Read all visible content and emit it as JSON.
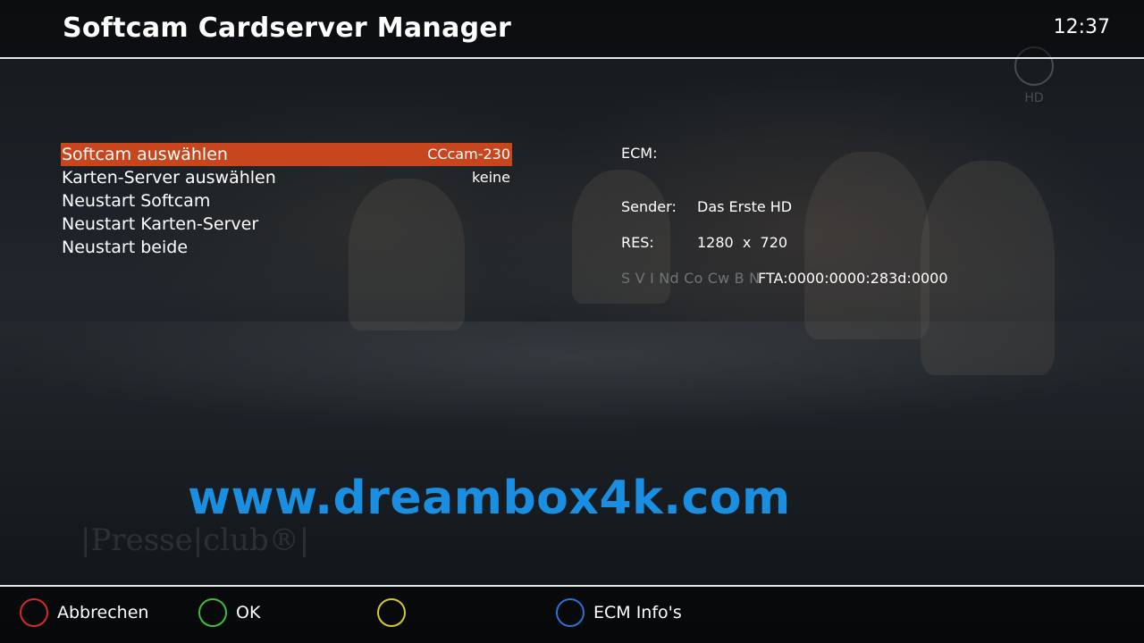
{
  "header": {
    "title": "Softcam Cardserver Manager",
    "clock": "12:37"
  },
  "channel_badge": {
    "label": "HD"
  },
  "menu": {
    "items": [
      {
        "label": "Softcam auswählen",
        "value": "CCcam-230",
        "selected": true
      },
      {
        "label": "Karten-Server auswählen",
        "value": "keine",
        "selected": false
      },
      {
        "label": "Neustart Softcam",
        "value": "",
        "selected": false
      },
      {
        "label": "Neustart Karten-Server",
        "value": "",
        "selected": false
      },
      {
        "label": "Neustart beide",
        "value": "",
        "selected": false
      }
    ],
    "selected_color": "#c8461e"
  },
  "info": {
    "ecm_label": "ECM:",
    "ecm_value": "",
    "sender_label": "Sender:",
    "sender_value": "Das Erste HD",
    "res_label": "RES:",
    "res_value": "1280  x  720",
    "flags": "S V I Nd Co Cw B N",
    "fta": "FTA:0000:0000:283d:0000"
  },
  "watermark": {
    "text": "www.dreambox4k.com",
    "color": "#1a8ee0"
  },
  "background": {
    "watermark_text": "|Presse|club®|"
  },
  "footer": {
    "keys": [
      {
        "color": "#d42a2a",
        "label": "Abbrechen",
        "icon": "red-button-icon"
      },
      {
        "color": "#3cbf3c",
        "label": "OK",
        "icon": "green-button-icon"
      },
      {
        "color": "#d8c82a",
        "label": "",
        "icon": "yellow-button-icon"
      },
      {
        "color": "#2a72d4",
        "label": "ECM Info's",
        "icon": "blue-button-icon"
      }
    ]
  }
}
